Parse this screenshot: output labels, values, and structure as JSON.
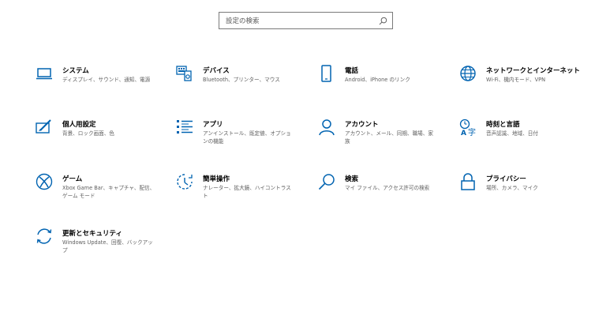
{
  "search": {
    "placeholder": "設定の検索"
  },
  "tiles": [
    {
      "title": "システム",
      "desc": "ディスプレイ、サウンド、通知、電源",
      "icon": "laptop-icon"
    },
    {
      "title": "デバイス",
      "desc": "Bluetooth、プリンター、マウス",
      "icon": "devices-icon"
    },
    {
      "title": "電話",
      "desc": "Android、iPhone のリンク",
      "icon": "phone-icon"
    },
    {
      "title": "ネットワークとインターネット",
      "desc": "Wi-Fi、機内モード、VPN",
      "icon": "globe-icon"
    },
    {
      "title": "個人用設定",
      "desc": "背景、ロック画面、色",
      "icon": "personalization-icon"
    },
    {
      "title": "アプリ",
      "desc": "アンインストール、既定値、オプションの機能",
      "icon": "apps-list-icon"
    },
    {
      "title": "アカウント",
      "desc": "アカウント、メール、同期、職場、家族",
      "icon": "person-icon"
    },
    {
      "title": "時刻と言語",
      "desc": "音声認識、地域、日付",
      "icon": "time-language-icon"
    },
    {
      "title": "ゲーム",
      "desc": "Xbox Game Bar、キャプチャ、配信、ゲーム モード",
      "icon": "xbox-icon"
    },
    {
      "title": "簡単操作",
      "desc": "ナレーター、拡大鏡、ハイコントラスト",
      "icon": "ease-of-access-icon"
    },
    {
      "title": "検索",
      "desc": "マイ ファイル、アクセス許可の検索",
      "icon": "search-icon"
    },
    {
      "title": "プライバシー",
      "desc": "場所、カメラ、マイク",
      "icon": "lock-icon"
    },
    {
      "title": "更新とセキュリティ",
      "desc": "Windows Update、回復、バックアップ",
      "icon": "sync-icon"
    }
  ],
  "colors": {
    "accent": "#0063b1"
  }
}
